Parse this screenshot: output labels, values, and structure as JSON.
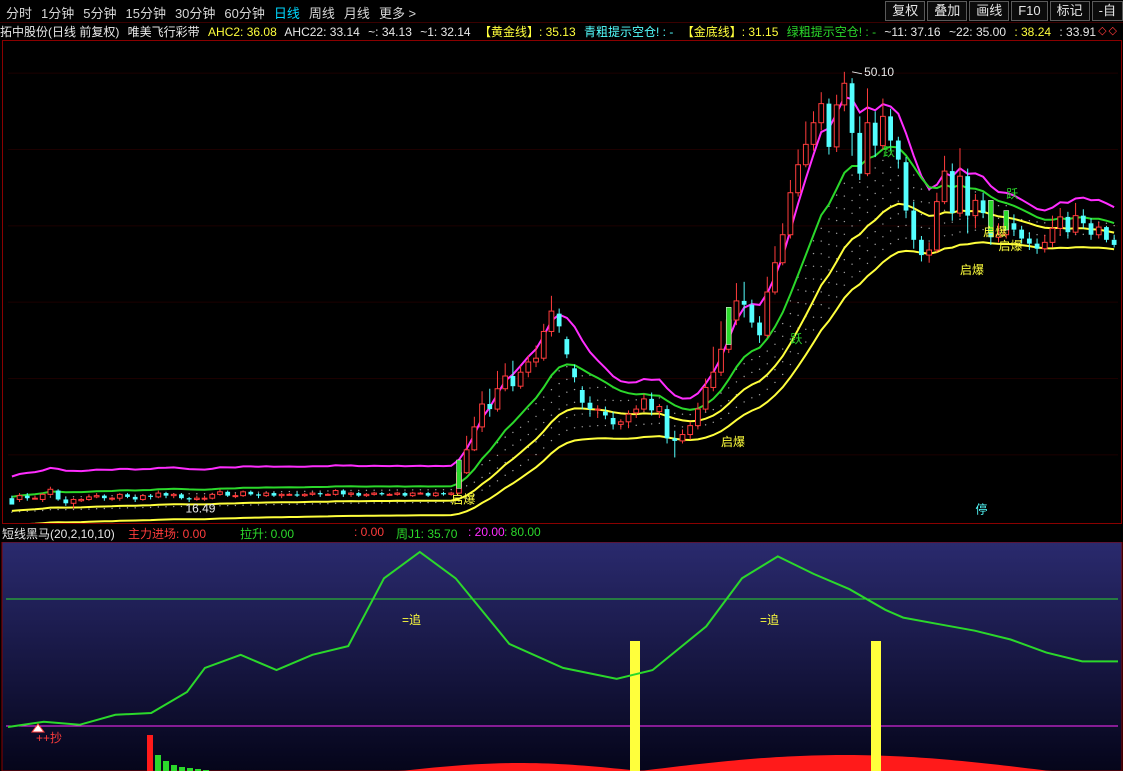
{
  "toolbar": {
    "periods": [
      "分时",
      "1分钟",
      "5分钟",
      "15分钟",
      "30分钟",
      "60分钟",
      "日线",
      "周线",
      "月线",
      "更多 >"
    ],
    "active": "日线",
    "right_buttons": [
      "复权",
      "叠加",
      "画线",
      "F10",
      "标记",
      "-自"
    ]
  },
  "info": {
    "stock": "拓中股份(日线 前复权)",
    "indicator": "唯美飞行彩带",
    "ahc2": "AHC2: 36.08",
    "ahc22": "AHC22: 33.14",
    "v1": "~: 34.13",
    "v2": "~1: 32.14",
    "gold_line": "【黄金线】: 35.13",
    "cyan_hint": "青粗提示空仓! : -",
    "gold_bottom": "【金底线】: 31.15",
    "green_hint": "绿粗提示空仓! : -",
    "v11": "~11: 37.16",
    "v22": "~22: 35.00",
    "v3": ": 38.24",
    "v4": ": 33.91",
    "diamonds": "◇◇"
  },
  "main_chart": {
    "high_label": "50.10",
    "low_label": "16.49",
    "signals": {
      "yue": "跃",
      "qibao": "启爆",
      "ting": "停"
    }
  },
  "sub": {
    "name": "短线黑马(20,2,10,10)",
    "main_entry": "主力进场: 0.00",
    "lift": "拉升: 0.00",
    "val": ": 0.00",
    "weekly_j": "周J1: 35.70",
    "v20": ": 20.00",
    "v80": ": 80.00",
    "zhui": "=追",
    "chao": "++抄"
  },
  "colors": {
    "up": "#ff3c3c",
    "down": "#54ffff",
    "magenta": "#ff2dff",
    "yellow": "#ffff3c",
    "green": "#2bd82b"
  },
  "candles": [
    [
      16.6,
      16.1,
      16.4,
      16.8
    ],
    [
      16.5,
      16.8,
      16.3,
      17.0
    ],
    [
      16.8,
      16.6,
      16.4,
      17.0
    ],
    [
      16.6,
      16.6,
      16.5,
      16.8
    ],
    [
      16.5,
      16.9,
      16.3,
      17.0
    ],
    [
      16.9,
      17.3,
      16.8,
      17.5
    ],
    [
      17.2,
      16.5,
      16.4,
      17.3
    ],
    [
      16.5,
      16.2,
      16.0,
      16.7
    ],
    [
      16.2,
      16.5,
      15.8,
      16.6
    ],
    [
      16.4,
      16.5,
      16.3,
      16.6
    ],
    [
      16.5,
      16.7,
      16.4,
      16.9
    ],
    [
      16.7,
      16.8,
      16.6,
      17.0
    ],
    [
      16.8,
      16.6,
      16.4,
      16.9
    ],
    [
      16.6,
      16.6,
      16.4,
      16.7
    ],
    [
      16.6,
      16.9,
      16.4,
      17.0
    ],
    [
      16.9,
      16.7,
      16.6,
      17.0
    ],
    [
      16.7,
      16.5,
      16.3,
      16.8
    ],
    [
      16.5,
      16.8,
      16.4,
      16.9
    ],
    [
      16.8,
      16.7,
      16.5,
      16.9
    ],
    [
      16.7,
      17.0,
      16.6,
      17.2
    ],
    [
      17.0,
      16.8,
      16.6,
      17.1
    ],
    [
      16.8,
      16.9,
      16.6,
      17.0
    ],
    [
      16.9,
      16.6,
      16.5,
      17.0
    ],
    [
      16.6,
      16.5,
      16.3,
      16.7
    ],
    [
      16.5,
      16.6,
      16.4,
      16.8
    ],
    [
      16.6,
      16.6,
      16.4,
      16.8
    ],
    [
      16.6,
      16.9,
      16.5,
      17.0
    ],
    [
      16.9,
      17.1,
      16.8,
      17.3
    ],
    [
      17.1,
      16.8,
      16.7,
      17.2
    ],
    [
      16.8,
      16.8,
      16.6,
      17.0
    ],
    [
      16.8,
      17.1,
      16.7,
      17.2
    ],
    [
      17.1,
      16.9,
      16.8,
      17.2
    ],
    [
      16.9,
      16.8,
      16.6,
      17.0
    ],
    [
      16.8,
      17.0,
      16.7,
      17.1
    ],
    [
      17.0,
      16.8,
      16.7,
      17.1
    ],
    [
      16.8,
      16.9,
      16.6,
      17.0
    ],
    [
      16.9,
      16.9,
      16.8,
      17.0
    ],
    [
      16.9,
      16.8,
      16.7,
      17.1
    ],
    [
      16.8,
      16.9,
      16.7,
      17.0
    ],
    [
      16.9,
      17.0,
      16.8,
      17.1
    ],
    [
      17.0,
      16.9,
      16.7,
      17.1
    ],
    [
      16.9,
      16.9,
      16.8,
      17.0
    ],
    [
      16.9,
      17.2,
      16.8,
      17.3
    ],
    [
      17.2,
      16.9,
      16.7,
      17.3
    ],
    [
      16.9,
      17.0,
      16.7,
      17.1
    ],
    [
      17.0,
      16.8,
      16.7,
      17.1
    ],
    [
      16.8,
      16.9,
      16.7,
      17.0
    ],
    [
      16.9,
      17.0,
      16.8,
      17.1
    ],
    [
      17.0,
      16.9,
      16.8,
      17.1
    ],
    [
      16.9,
      16.9,
      16.8,
      17.0
    ],
    [
      16.9,
      17.0,
      16.8,
      17.1
    ],
    [
      17.0,
      16.8,
      16.7,
      17.1
    ],
    [
      16.8,
      17.0,
      16.7,
      17.1
    ],
    [
      17.0,
      17.0,
      16.9,
      17.1
    ],
    [
      17.0,
      16.8,
      16.7,
      17.1
    ],
    [
      16.8,
      17.0,
      16.7,
      17.1
    ],
    [
      17.0,
      16.9,
      16.8,
      17.1
    ],
    [
      16.9,
      17.0,
      16.8,
      17.1
    ],
    [
      17.0,
      18.6,
      16.9,
      18.7
    ],
    [
      18.6,
      20.4,
      18.5,
      21.5
    ],
    [
      20.4,
      22.2,
      20.3,
      23.0
    ],
    [
      22.2,
      24.0,
      21.8,
      25.0
    ],
    [
      24.0,
      23.6,
      23.0,
      25.2
    ],
    [
      23.6,
      25.2,
      23.4,
      26.6
    ],
    [
      25.2,
      26.2,
      25.0,
      27.2
    ],
    [
      26.2,
      25.4,
      25.0,
      27.4
    ],
    [
      25.4,
      26.5,
      25.2,
      27.0
    ],
    [
      26.5,
      27.3,
      26.1,
      27.8
    ],
    [
      27.3,
      27.6,
      26.9,
      28.6
    ],
    [
      27.6,
      29.7,
      27.4,
      30.3
    ],
    [
      29.7,
      31.3,
      29.3,
      32.5
    ],
    [
      31.1,
      30.1,
      29.6,
      31.5
    ],
    [
      29.1,
      27.9,
      27.6,
      29.3
    ],
    [
      26.8,
      26.1,
      25.7,
      27.1
    ],
    [
      25.1,
      24.1,
      23.6,
      25.4
    ],
    [
      24.1,
      23.6,
      23.0,
      24.6
    ],
    [
      23.6,
      23.6,
      22.9,
      23.9
    ],
    [
      23.4,
      23.1,
      22.8,
      23.8
    ],
    [
      22.9,
      22.4,
      22.0,
      23.4
    ],
    [
      22.4,
      22.6,
      22.0,
      22.8
    ],
    [
      22.6,
      23.2,
      22.1,
      23.5
    ],
    [
      23.3,
      23.6,
      22.9,
      23.9
    ],
    [
      23.6,
      24.4,
      23.4,
      24.8
    ],
    [
      24.4,
      23.5,
      23.1,
      24.9
    ],
    [
      23.4,
      23.8,
      22.9,
      24.0
    ],
    [
      23.6,
      21.3,
      20.9,
      23.9
    ],
    [
      21.3,
      21.1,
      19.8,
      21.9
    ],
    [
      21.1,
      21.6,
      20.9,
      22.0
    ],
    [
      21.6,
      22.3,
      21.2,
      22.6
    ],
    [
      22.3,
      23.6,
      22.0,
      24.1
    ],
    [
      23.6,
      25.3,
      23.4,
      26.0
    ],
    [
      25.3,
      26.5,
      25.0,
      28.5
    ],
    [
      26.5,
      28.3,
      26.2,
      30.5
    ],
    [
      28.3,
      30.6,
      28.0,
      31.6
    ],
    [
      30.6,
      32.1,
      30.2,
      33.5
    ],
    [
      32.1,
      31.8,
      30.8,
      33.6
    ],
    [
      31.8,
      30.4,
      30.0,
      32.2
    ],
    [
      30.4,
      29.4,
      28.8,
      30.9
    ],
    [
      29.4,
      32.8,
      29.2,
      34.0
    ],
    [
      32.8,
      35.1,
      32.6,
      36.4
    ],
    [
      35.1,
      37.3,
      34.9,
      38.2
    ],
    [
      37.3,
      40.6,
      37.0,
      41.6
    ],
    [
      40.6,
      42.8,
      40.3,
      44.0
    ],
    [
      42.8,
      44.4,
      42.6,
      46.2
    ],
    [
      44.4,
      46.1,
      43.9,
      47.0
    ],
    [
      46.1,
      47.6,
      45.5,
      48.5
    ],
    [
      47.6,
      44.2,
      43.6,
      48.0
    ],
    [
      44.2,
      47.5,
      43.8,
      48.3
    ],
    [
      47.5,
      49.2,
      47.0,
      50.1
    ],
    [
      49.2,
      45.3,
      43.5,
      49.6
    ],
    [
      45.3,
      42.1,
      41.6,
      46.6
    ],
    [
      42.1,
      46.1,
      41.9,
      48.8
    ],
    [
      46.1,
      44.3,
      43.4,
      47.0
    ],
    [
      44.3,
      46.6,
      44.0,
      48.0
    ],
    [
      46.6,
      44.7,
      43.9,
      47.2
    ],
    [
      44.7,
      43.2,
      42.5,
      45.0
    ],
    [
      43.0,
      39.2,
      38.6,
      43.4
    ],
    [
      39.2,
      36.9,
      36.2,
      39.9
    ],
    [
      36.9,
      35.7,
      35.2,
      37.2
    ],
    [
      35.7,
      36.1,
      35.1,
      36.7
    ],
    [
      36.1,
      39.9,
      35.9,
      40.6
    ],
    [
      39.9,
      42.3,
      39.7,
      43.5
    ],
    [
      42.3,
      39.0,
      38.4,
      42.9
    ],
    [
      39.0,
      41.9,
      38.7,
      44.1
    ],
    [
      41.9,
      38.8,
      37.4,
      42.5
    ],
    [
      38.8,
      40.0,
      37.8,
      40.5
    ],
    [
      40.0,
      39.0,
      38.6,
      40.6
    ],
    [
      39.0,
      37.1,
      36.5,
      39.4
    ],
    [
      37.1,
      37.3,
      36.7,
      38.2
    ],
    [
      37.3,
      38.2,
      37.0,
      39.2
    ],
    [
      38.2,
      37.7,
      37.2,
      38.9
    ],
    [
      37.7,
      37.0,
      36.6,
      38.0
    ],
    [
      37.0,
      36.6,
      36.1,
      37.5
    ],
    [
      36.6,
      36.2,
      35.8,
      37.0
    ],
    [
      36.2,
      36.7,
      35.9,
      37.3
    ],
    [
      36.7,
      37.8,
      36.3,
      38.8
    ],
    [
      37.8,
      38.7,
      37.2,
      39.4
    ],
    [
      38.7,
      37.5,
      37.0,
      39.1
    ],
    [
      37.5,
      38.8,
      37.3,
      39.8
    ],
    [
      38.8,
      38.2,
      37.8,
      39.3
    ],
    [
      38.2,
      37.3,
      36.9,
      38.6
    ],
    [
      37.3,
      37.9,
      37.0,
      38.3
    ],
    [
      37.9,
      36.9,
      36.7,
      38.0
    ],
    [
      36.9,
      36.5,
      36.3,
      37.3
    ]
  ],
  "kdj": [
    [
      0,
      0.0
    ],
    [
      2,
      1.2
    ],
    [
      4,
      0.5
    ],
    [
      6,
      2.8
    ],
    [
      8,
      3.2
    ],
    [
      10,
      8.0
    ],
    [
      11,
      13.5
    ],
    [
      13,
      16.5
    ],
    [
      15,
      13.0
    ],
    [
      17,
      16.5
    ],
    [
      19,
      18.5
    ],
    [
      21,
      34.0
    ],
    [
      23,
      40.0
    ],
    [
      25,
      34.0
    ],
    [
      26,
      29.0
    ],
    [
      28,
      19.0
    ],
    [
      31,
      13.5
    ],
    [
      34,
      11.0
    ],
    [
      36,
      13.0
    ],
    [
      39,
      23.0
    ],
    [
      41,
      34.0
    ],
    [
      43,
      39.0
    ],
    [
      45,
      35.0
    ],
    [
      47,
      31.5
    ],
    [
      49,
      26.8
    ],
    [
      50,
      25.0
    ],
    [
      52,
      23.5
    ],
    [
      54,
      22.0
    ],
    [
      56,
      20.0
    ],
    [
      58,
      17.0
    ],
    [
      60,
      15.0
    ],
    [
      62,
      15.0
    ]
  ],
  "bars": [
    {
      "x": 13,
      "type": "yellow"
    },
    {
      "x": 40,
      "type": "yellow"
    }
  ]
}
